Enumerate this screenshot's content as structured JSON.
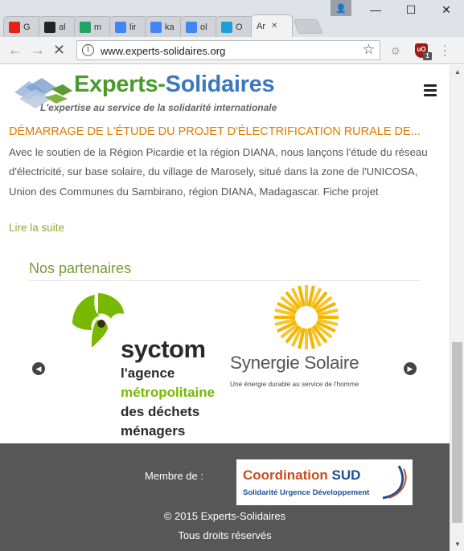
{
  "browser": {
    "tabs": [
      {
        "favicon": "youtube-icon",
        "color": "#e62117",
        "title": "G"
      },
      {
        "favicon": "github-icon",
        "color": "#222222",
        "title": "al"
      },
      {
        "favicon": "google-drive-icon",
        "color": "#1fa463",
        "title": "m"
      },
      {
        "favicon": "google-icon",
        "color": "#4285f4",
        "title": "lir"
      },
      {
        "favicon": "google-icon",
        "color": "#4285f4",
        "title": "ka"
      },
      {
        "favicon": "google-icon",
        "color": "#4285f4",
        "title": "ol"
      },
      {
        "favicon": "bd-icon",
        "color": "#1aa0d8",
        "title": "O"
      },
      {
        "favicon": "",
        "color": "#f2f2f2",
        "title": "Ar",
        "active": true
      }
    ],
    "window_controls": {
      "minimize": "—",
      "maximize": "☐",
      "close": "✕"
    },
    "url": "www.experts-solidaires.org",
    "extension_badge": "1"
  },
  "site": {
    "logo_name_green": "Experts-",
    "logo_name_blue": "Solidaires",
    "tagline": "L'expertise au service de la solidarité internationale"
  },
  "post": {
    "title": "DÉMARRAGE DE L'ÉTUDE DU PROJET D'ÉLECTRIFICATION RURALE DE...",
    "body": "Avec le soutien de la Région Picardie et la région DIANA, nous lançons l'étude du réseau d'électricité, sur base solaire, du village de Marosely, situé dans la zone de l'UNICOSA, Union des Communes du Sambirano, région DIANA, Madagascar.  Fiche projet",
    "read_more": "Lire la suite"
  },
  "partners": {
    "heading": "Nos partenaires",
    "syctom": {
      "name": "syctom",
      "line1": "l'agence",
      "line2": "métropolitaine",
      "line3": "des déchets",
      "line4": "ménagers"
    },
    "synergie": {
      "name": "Synergie Solaire",
      "tagline": "Une énergie durable au service de l'homme"
    },
    "prev_arrow": "◀",
    "next_arrow": "▶"
  },
  "footer": {
    "member_label": "Membre de :",
    "coordination_a": "Coordination ",
    "coordination_b": "SUD",
    "coordination_tagline": "Solidarité Urgence Développement",
    "copyright": "© 2015 Experts-Solidaires",
    "rights": "Tous droits réservés"
  }
}
